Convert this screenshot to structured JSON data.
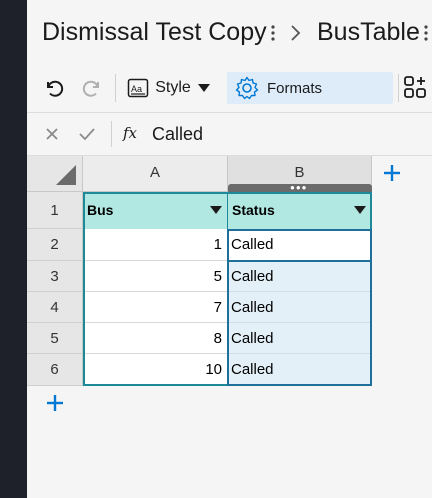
{
  "window": {
    "document_title": "Dismissal Test Copy",
    "table_name": "BusTable"
  },
  "toolbar": {
    "style_label": "Style",
    "formats_label": "Formats",
    "style_icon_text": "Aa"
  },
  "formula_bar": {
    "fx_label": "fx",
    "value": "Called"
  },
  "grid": {
    "columns": [
      "A",
      "B"
    ],
    "rows": [
      "1",
      "2",
      "3",
      "4",
      "5",
      "6"
    ],
    "header_row": {
      "col_a": "Bus",
      "col_b": "Status"
    },
    "data_rows": [
      {
        "bus": "1",
        "status": "Called"
      },
      {
        "bus": "5",
        "status": "Called"
      },
      {
        "bus": "7",
        "status": "Called"
      },
      {
        "bus": "8",
        "status": "Called"
      },
      {
        "bus": "10",
        "status": "Called"
      }
    ],
    "active_cell": "B2"
  },
  "colors": {
    "accent": "#0078d4",
    "table_header_bg": "#b2e8e2",
    "table_border": "#1e8a99",
    "selection_bg": "#e4f0f8",
    "formats_button_bg": "#deecf9"
  }
}
